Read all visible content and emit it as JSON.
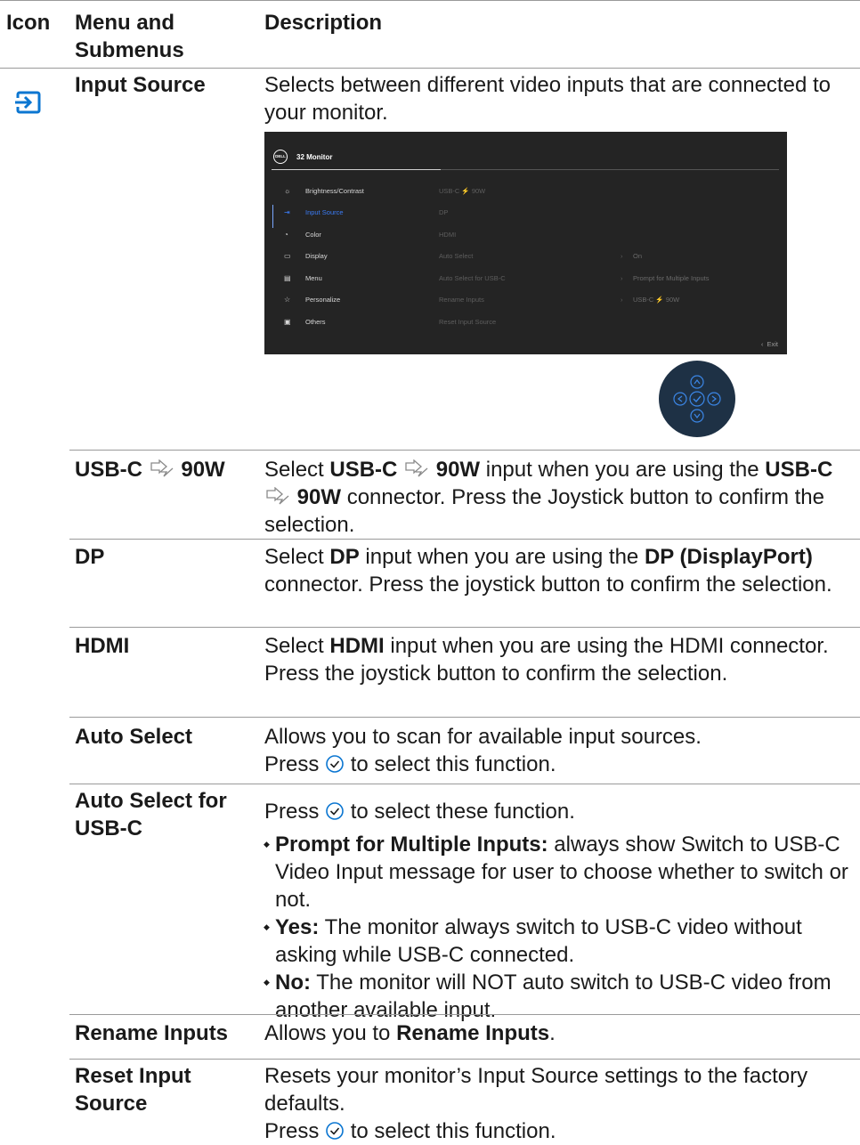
{
  "header": {
    "icon": "Icon",
    "menu": "Menu and Submenus",
    "description": "Description"
  },
  "input_source": {
    "icon": "input-source-icon",
    "name": "Input Source",
    "description": "Selects between different video inputs that are connected to your monitor."
  },
  "osd": {
    "model": "32 Monitor",
    "logo": "DELL",
    "menu_items": [
      "Brightness/Contrast",
      "Input Source",
      "Color",
      "Display",
      "Menu",
      "Personalize",
      "Others"
    ],
    "mid_items": [
      "USB-C ⚡ 90W",
      "DP",
      "HDMI",
      "Auto Select",
      "Auto Select for USB-C",
      "Rename Inputs",
      "Reset Input Source"
    ],
    "right_values": [
      "On",
      "Prompt for Multiple Inputs",
      "USB-C ⚡ 90W"
    ],
    "exit": "Exit"
  },
  "rows": {
    "usbc": {
      "name_prefix": "USB-C",
      "name_suffix": "90W",
      "d1": "Select ",
      "d1b": "USB-C",
      "d1c": "90W",
      "d2": " input when you are using the ",
      "d3b": "USB-C",
      "d3c": "90W",
      "d4": " connector. Press the Joystick button to confirm the selection."
    },
    "dp": {
      "name": "DP",
      "d1": "Select ",
      "d1b": "DP",
      "d2": " input when you are using the ",
      "d2b": "DP (DisplayPort)",
      "d3": " connector. Press the joystick button to confirm the selection."
    },
    "hdmi": {
      "name": "HDMI",
      "d1": "Select ",
      "d1b": "HDMI",
      "d2": " input when you are using the HDMI connector. Press the joystick button to confirm the selection."
    },
    "auto_select": {
      "name": "Auto Select",
      "line1": "Allows you to scan for available input sources.",
      "press": "Press",
      "press_tail": "to select this function."
    },
    "auto_select_usbc": {
      "name_line1": "Auto Select for",
      "name_line2": "USB-C",
      "press": "Press",
      "press_tail": "to select these function.",
      "bullets": [
        {
          "bold": "Prompt for Multiple Inputs:",
          "text": " always show Switch to USB-C Video Input message for user to choose whether to switch or not."
        },
        {
          "bold": "Yes:",
          "text": " The monitor always switch to USB-C video without asking while USB-C connected."
        },
        {
          "bold": "No:",
          "text": " The monitor will NOT auto switch to USB-C video from another available input."
        }
      ]
    },
    "rename": {
      "name": "Rename Inputs",
      "d1": "Allows you to ",
      "d1b": "Rename Inputs",
      "d2": "."
    },
    "reset": {
      "name_line1": "Reset Input",
      "name_line2": "Source",
      "d1": "Resets your monitor’s ",
      "d1b": "Input Source",
      "d2": " settings to the factory defaults.",
      "press": "Press",
      "press_tail": "to select this function."
    }
  }
}
